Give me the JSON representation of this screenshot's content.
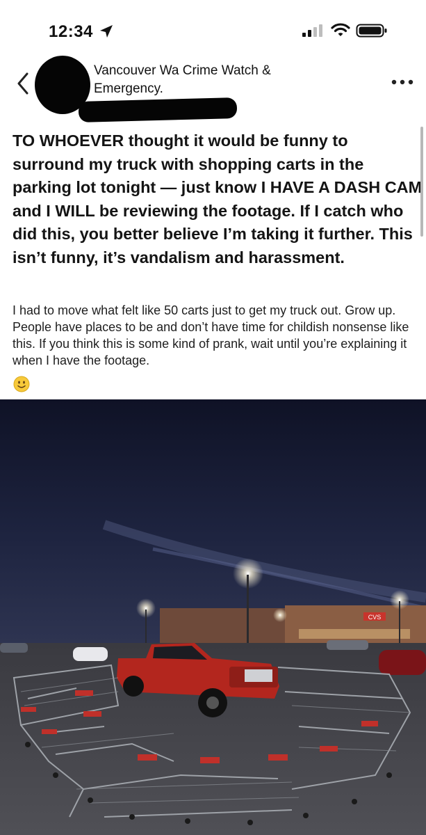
{
  "status_bar": {
    "time": "12:34",
    "icons": [
      "location-arrow-icon",
      "cellular-signal-icon",
      "wifi-icon",
      "battery-icon"
    ]
  },
  "header": {
    "group_name": "Vancouver Wa Crime Watch & Emergency.",
    "back_icon": "chevron-left-icon",
    "more_icon": "more-horizontal-icon"
  },
  "post": {
    "headline": "TO WHOEVER thought it would be funny to surround my truck with shopping carts in the parking lot tonight — just know I HAVE A DASH CAM and I WILL be reviewing the footage. If I catch who did this, you better believe I’m taking it further. This isn’t funny, it’s vandalism and harassment.",
    "body": "I had to move what felt like 50 carts just to get my truck out. Grow up. People have places to be and don’t have time for childish nonsense like this. If you think this is some kind of prank, wait until you’re explaining it when I have the footage.",
    "emoji": "slightly-smiling-face-icon",
    "store_sign": "CVS"
  },
  "colors": {
    "sky": "#1b1f33",
    "truck": "#b3261e",
    "cart_handle": "#c0302a",
    "text": "#111111"
  }
}
